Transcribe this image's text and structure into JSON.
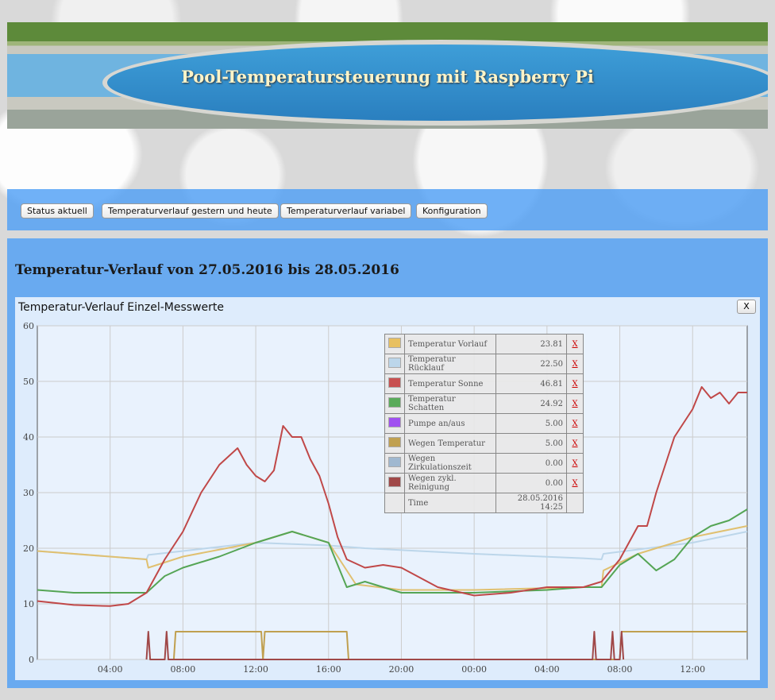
{
  "header": {
    "title": "Pool-Temperatursteuerung mit Raspberry Pi"
  },
  "nav": {
    "items": [
      {
        "label": "Status aktuell"
      },
      {
        "label": "Temperaturverlauf gestern und heute"
      },
      {
        "label": "Temperaturverlauf variabel"
      },
      {
        "label": "Konfiguration"
      }
    ]
  },
  "main": {
    "heading": "Temperatur-Verlauf von 27.05.2016 bis 28.05.2016"
  },
  "panel": {
    "title": "Temperatur-Verlauf Einzel-Messwerte",
    "close_label": "X"
  },
  "legend": {
    "remove_label": "X",
    "rows": [
      {
        "name": "Temperatur Vorlauf",
        "value": "23.81",
        "color": "#e8c060"
      },
      {
        "name": "Temperatur Rücklauf",
        "value": "22.50",
        "color": "#bcd6ea"
      },
      {
        "name": "Temperatur Sonne",
        "value": "46.81",
        "color": "#c85050"
      },
      {
        "name": "Temperatur Schatten",
        "value": "24.92",
        "color": "#5aab5a"
      },
      {
        "name": "Pumpe an/aus",
        "value": "5.00",
        "color": "#a050f0"
      },
      {
        "name": "Wegen Temperatur",
        "value": "5.00",
        "color": "#c0a050"
      },
      {
        "name": "Wegen Zirkulationszeit",
        "value": "0.00",
        "color": "#a0b8d0"
      },
      {
        "name": "Wegen zykl. Reinigung",
        "value": "0.00",
        "color": "#a04848"
      }
    ],
    "time_label": "Time",
    "time_value": "28.05.2016 14:25"
  },
  "chart_data": {
    "type": "line",
    "ylim": [
      0,
      60
    ],
    "yticks": [
      "0",
      "10",
      "20",
      "30",
      "40",
      "50",
      "60"
    ],
    "xticks": [
      "04:00",
      "08:00",
      "12:00",
      "16:00",
      "20:00",
      "00:00",
      "04:00",
      "08:00",
      "12:00"
    ],
    "x_hours_range": [
      0,
      39
    ],
    "series": [
      {
        "name": "Temperatur Rücklauf",
        "color": "#bcd6ea",
        "x": [
          0,
          6,
          6.1,
          8,
          12,
          16,
          18,
          24,
          30,
          31,
          31.1,
          36,
          39
        ],
        "y": [
          19.5,
          18,
          18.8,
          19.5,
          21,
          20.5,
          20,
          19,
          18.2,
          18,
          19,
          21,
          23
        ]
      },
      {
        "name": "Temperatur Vorlauf",
        "color": "#e0c070",
        "x": [
          0,
          6,
          6.1,
          8,
          12,
          14,
          16,
          17.5,
          20,
          24,
          30,
          31,
          31.1,
          33,
          36,
          39
        ],
        "y": [
          19.5,
          18,
          16.5,
          18.5,
          21,
          23,
          21,
          13.5,
          12.5,
          12.5,
          13,
          13,
          16,
          19,
          22,
          24
        ]
      },
      {
        "name": "Temperatur Schatten",
        "color": "#55a555",
        "x": [
          0,
          2,
          4,
          6,
          7,
          8,
          10,
          12,
          14,
          16,
          17,
          18,
          20,
          22,
          24,
          28,
          30,
          31,
          32,
          33,
          34,
          35,
          36,
          37,
          38,
          39
        ],
        "y": [
          12.5,
          12,
          12,
          12,
          15,
          16.5,
          18.5,
          21,
          23,
          21,
          13,
          14,
          12,
          12,
          12,
          12.5,
          13,
          13,
          17,
          19,
          16,
          18,
          22,
          24,
          25,
          27
        ]
      },
      {
        "name": "Temperatur Sonne",
        "color": "#c04848",
        "x": [
          0,
          2,
          4,
          5,
          6,
          7,
          8,
          9,
          10,
          11,
          11.5,
          12,
          12.5,
          13,
          13.5,
          14,
          14.5,
          15,
          15.5,
          16,
          16.5,
          17,
          18,
          19,
          20,
          22,
          24,
          26,
          28,
          30,
          31,
          32,
          32.5,
          33,
          33.5,
          34,
          35,
          36,
          36.5,
          37,
          37.5,
          38,
          38.5,
          39
        ],
        "y": [
          10.5,
          9.8,
          9.6,
          10,
          12,
          18,
          23,
          30,
          35,
          38,
          35,
          33,
          32,
          34,
          42,
          40,
          40,
          36,
          33,
          28,
          22,
          18,
          16.5,
          17,
          16.5,
          13,
          11.5,
          12,
          13,
          13,
          14,
          18,
          21,
          24,
          24,
          30,
          40,
          45,
          49,
          47,
          48,
          46,
          48,
          48
        ]
      },
      {
        "name": "Wegen Temperatur",
        "color": "#c0a050",
        "x": [
          7.5,
          7.6,
          12.3,
          12.4,
          12.5,
          16.5,
          17,
          17.1,
          32,
          32.1,
          39
        ],
        "y": [
          0,
          5,
          5,
          0,
          5,
          5,
          5,
          0,
          0,
          5,
          5
        ]
      },
      {
        "name": "Wegen zykl. Reinigung",
        "color": "#a04848",
        "x": [
          6,
          6.1,
          6.2,
          7,
          7.1,
          7.2,
          30.5,
          30.6,
          30.7,
          31.5,
          31.6,
          31.7,
          32,
          32.1,
          32.2
        ],
        "y": [
          0,
          5,
          0,
          0,
          5,
          0,
          0,
          5,
          0,
          0,
          5,
          0,
          0,
          5,
          0
        ]
      }
    ]
  }
}
